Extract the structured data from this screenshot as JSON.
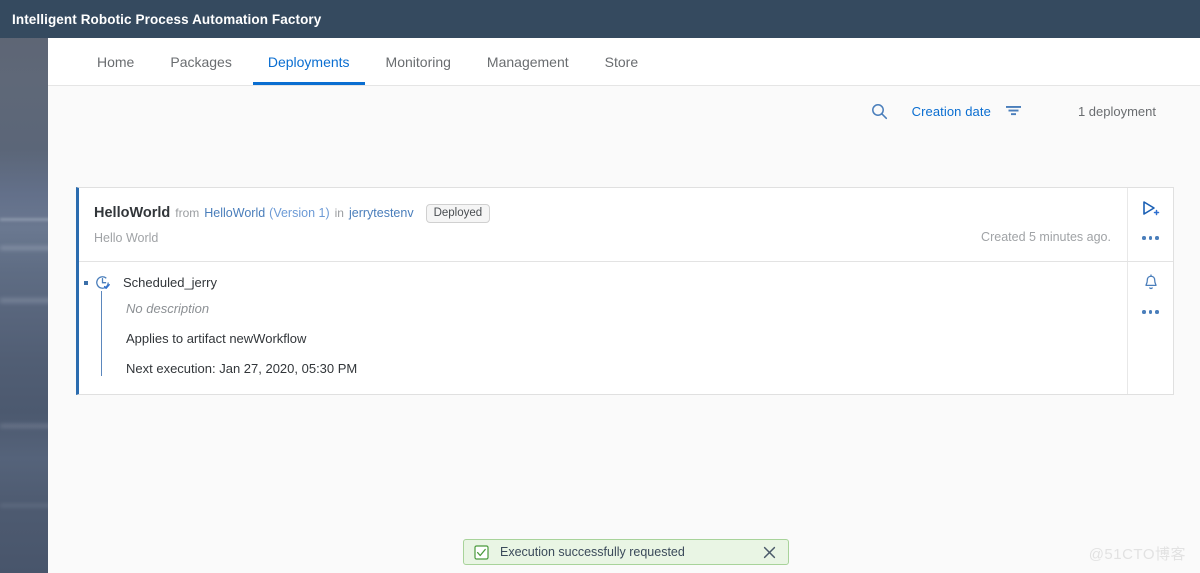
{
  "header": {
    "title": "Intelligent Robotic Process Automation Factory",
    "background_color": "#354a5f"
  },
  "tabs": [
    {
      "label": "Home",
      "active": false
    },
    {
      "label": "Packages",
      "active": false
    },
    {
      "label": "Deployments",
      "active": true
    },
    {
      "label": "Monitoring",
      "active": false
    },
    {
      "label": "Management",
      "active": false
    },
    {
      "label": "Store",
      "active": false
    }
  ],
  "toolbar": {
    "search_icon": "search-icon",
    "sort_label": "Creation date",
    "filter_icon": "filter-icon",
    "count_label": "1 deployment"
  },
  "deployment": {
    "name": "HelloWorld",
    "from_label": "from",
    "package": "HelloWorld",
    "version": "(Version 1)",
    "in_label": "in",
    "environment": "jerrytestenv",
    "status": "Deployed",
    "description": "Hello World",
    "created": "Created 5 minutes ago.",
    "run_icon": "run-play-add-icon",
    "more_icon": "overflow-menu-icon",
    "accent_color": "#2b6caf"
  },
  "schedule": {
    "icon": "clock-schedule-icon",
    "name": "Scheduled_jerry",
    "no_description": "No description",
    "applies_to": "Applies to artifact newWorkflow",
    "next_execution": "Next execution: Jan 27, 2020, 05:30 PM",
    "alert_icon": "bell-icon",
    "more_icon": "overflow-menu-icon"
  },
  "toast": {
    "icon": "checkbox-success-icon",
    "message": "Execution successfully requested",
    "close_icon": "close-icon",
    "background_color": "#e9f5e4",
    "border_color": "#a8d39a"
  },
  "watermark": {
    "text": "@51CTO博客"
  }
}
